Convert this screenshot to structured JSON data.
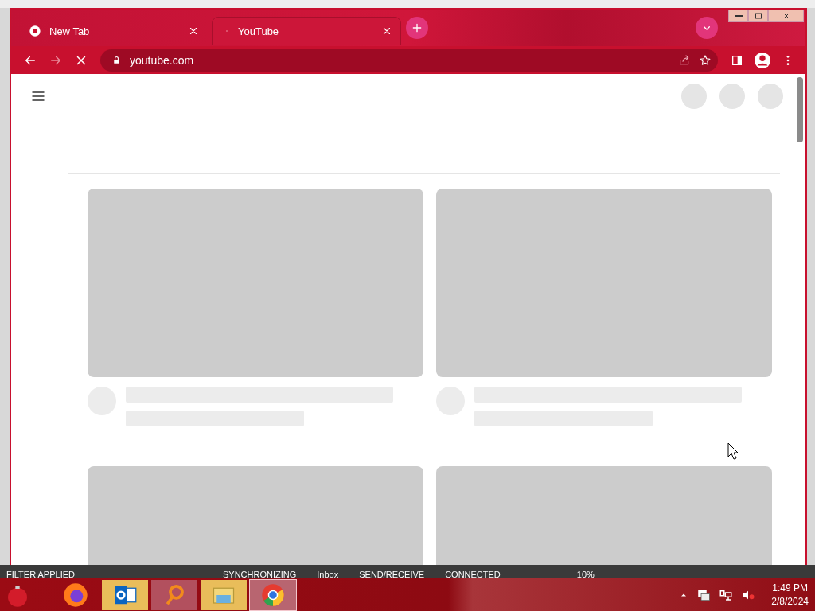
{
  "browser": {
    "tabs": [
      {
        "title": "New Tab",
        "selected": false,
        "kind": "newtab"
      },
      {
        "title": "YouTube",
        "selected": true,
        "kind": "loading"
      }
    ],
    "address": "youtube.com",
    "loading": true,
    "forward_disabled": true
  },
  "page": {
    "video_cards": [
      {
        "kind": "skeleton"
      },
      {
        "kind": "skeleton"
      },
      {
        "kind": "thumbnail_only"
      },
      {
        "kind": "thumbnail_only"
      }
    ]
  },
  "status_strip": [
    "FILTER APPLIED",
    "SYNCHRONIZING",
    "Inbox",
    "SEND/RECEIVE",
    "CONNECTED",
    "10%"
  ],
  "taskbar": {
    "apps": [
      {
        "kind": "firefox",
        "selected": false
      },
      {
        "kind": "outlook",
        "selected": false,
        "color": "#e9bd5a"
      },
      {
        "kind": "search",
        "selected": false,
        "color": "#b2505e"
      },
      {
        "kind": "explorer",
        "selected": false,
        "color": "#e9bd5a"
      },
      {
        "kind": "chrome",
        "selected": true,
        "color": "#b86570"
      }
    ],
    "time": "1:49 PM",
    "date": "2/8/2024"
  }
}
